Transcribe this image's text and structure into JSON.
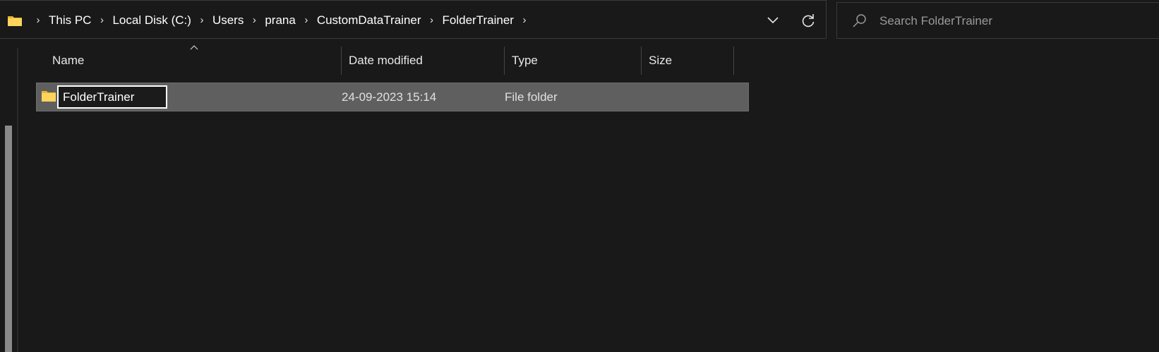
{
  "address_bar": {
    "crumbs": [
      "This PC",
      "Local Disk (C:)",
      "Users",
      "prana",
      "CustomDataTrainer",
      "FolderTrainer"
    ],
    "separator": "›",
    "folder_icon": "folder-icon",
    "dropdown_icon": "chevron-down-icon",
    "refresh_icon": "refresh-icon"
  },
  "search": {
    "placeholder": "Search FolderTrainer",
    "value": "",
    "icon": "search-icon"
  },
  "columns": {
    "name": "Name",
    "date_modified": "Date modified",
    "type": "Type",
    "size": "Size",
    "sort_indicator": "sort-ascending-icon"
  },
  "files": [
    {
      "name": "FolderTrainer",
      "date_modified": "24-09-2023 15:14",
      "type": "File folder",
      "size": "",
      "selected": true,
      "renaming": true
    }
  ],
  "colors": {
    "background": "#191919",
    "selected_row": "#5f5f5f",
    "folder_yellow": "#f5c542"
  }
}
